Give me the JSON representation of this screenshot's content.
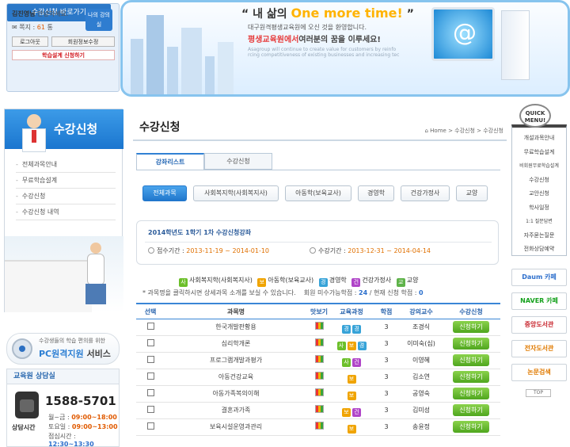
{
  "login": {
    "greeting_name": "김진영님",
    "greeting_rest": "안녕하세요.",
    "notes_label": "쪽지 :",
    "notes_count": "61",
    "notes_unit": "통",
    "my_room": "나의 강의실",
    "logout": "로그아웃",
    "member_edit": "회원정보수정",
    "plan_apply": "학습설계 신청하기",
    "shortcut": "수강신청 바로가기"
  },
  "banner": {
    "headline_pre": "“ 내 삶의",
    "headline_accent": "One more time!",
    "headline_post": "”",
    "sub1": "대구원격평생교육원에 오신 것을 환영합니다.",
    "sub2_pre": "평생교육원에서",
    "sub2_post": "여러분의 꿈을 이루세요!",
    "eng": "Asagroup will continue to create value for customers by reinfo rcing competitiveness of existing businesses and increasing tec"
  },
  "sidebar": {
    "title": "수강신청",
    "items": [
      "전체과목안내",
      "무료학습설계",
      "수강신청",
      "수강신청 내역"
    ]
  },
  "support": {
    "small": "수강생들의 학습 편의를 위한",
    "big_accent": "PC원격지원",
    "big_rest": "서비스"
  },
  "counsel": {
    "title": "교육원 상담실",
    "phone": "1588-5701",
    "hours_label": "상담시간",
    "hours": [
      {
        "label": "월~금 :",
        "time": "09:00~18:00"
      },
      {
        "label": "토요일 :",
        "time": "09:00~13:00"
      },
      {
        "label": "점심시간 :",
        "time": "12:30~13:30"
      }
    ]
  },
  "main": {
    "title": "수강신청",
    "breadcrumb": "Home > 수강신청 > 수강신청",
    "tabs": [
      "강좌리스트",
      "수강신청"
    ],
    "categories": [
      "전체과목",
      "사회복지학(사회복지사)",
      "아동학(보육교사)",
      "경영학",
      "건강가정사",
      "교양"
    ],
    "term_title": "2014학년도 1학기 1차 수강신청강좌",
    "apply_label": "접수기간 :",
    "apply_period": "2013-11-19 ~ 2014-01-10",
    "study_label": "수강기간 :",
    "study_period": "2013-12-31 ~ 2014-04-14",
    "legend": [
      {
        "badge": "사",
        "label": "사회복지학(사회복지사)",
        "color": "#6cbf2a"
      },
      {
        "badge": "보",
        "label": "아동학(보육교사)",
        "color": "#f0a400"
      },
      {
        "badge": "경",
        "label": "경영학",
        "color": "#37a3d8"
      },
      {
        "badge": "건",
        "label": "건강가정사",
        "color": "#b045c8"
      },
      {
        "badge": "교",
        "label": "교양",
        "color": "#5fb34a"
      }
    ],
    "note": "* 과목명을 클릭하시면 상세과목 소개를 보실 수 있습니다.",
    "note_remaining_label": "회원 미수가능학점 :",
    "note_remaining": "24",
    "note_current_label": "/ 현재 신청 학점 :",
    "note_current": "0",
    "table_headers": [
      "선택",
      "과목명",
      "맛보기",
      "교육과정",
      "학점",
      "강의교수",
      "수강신청"
    ],
    "rows": [
      {
        "name": "한국개발판황용",
        "badges": [
          "경",
          "경"
        ],
        "credit": "3",
        "prof": "조경식",
        "btn": "신청하기"
      },
      {
        "name": "심리학개론",
        "badges": [
          "사",
          "보",
          "경"
        ],
        "credit": "3",
        "prof": "이미숙(심)",
        "btn": "신청하기"
      },
      {
        "name": "프로그램개발과평가",
        "badges": [
          "사",
          "건"
        ],
        "credit": "3",
        "prof": "이영혜",
        "btn": "신청하기"
      },
      {
        "name": "아동건강교육",
        "badges": [
          "보"
        ],
        "credit": "3",
        "prof": "김소연",
        "btn": "신청하기"
      },
      {
        "name": "아동가족복의이해",
        "badges": [
          "보"
        ],
        "credit": "3",
        "prof": "공영숙",
        "btn": "신청하기"
      },
      {
        "name": "결혼과가족",
        "badges": [
          "보",
          "건"
        ],
        "credit": "3",
        "prof": "김미성",
        "btn": "신청하기"
      },
      {
        "name": "보육시설운영과관리",
        "badges": [
          "보"
        ],
        "credit": "3",
        "prof": "송윤정",
        "btn": "신청하기"
      }
    ]
  },
  "quick": {
    "badge": "QUICK MENU!",
    "items": [
      "개설과목안내",
      "무료학습설계",
      "비회원무료학습설계",
      "수강신청",
      "교안신청",
      "학사일정",
      "1:1 질문답변",
      "자주묻는질문",
      "전화상담예약"
    ],
    "ads": [
      {
        "label": "Daum 카페",
        "color": "#2d6fcc"
      },
      {
        "label": "NAVER 카페",
        "color": "#15a11d"
      },
      {
        "label": "중앙도서관",
        "color": "#c8262e"
      },
      {
        "label": "전자도서관",
        "color": "#e07a00"
      },
      {
        "label": "논문검색",
        "color": "#e07a00"
      }
    ],
    "top": "TOP"
  },
  "colors": {
    "accent": "#2b78c8",
    "apply_green": "#4fa61e",
    "period_orange": "#e07000"
  }
}
